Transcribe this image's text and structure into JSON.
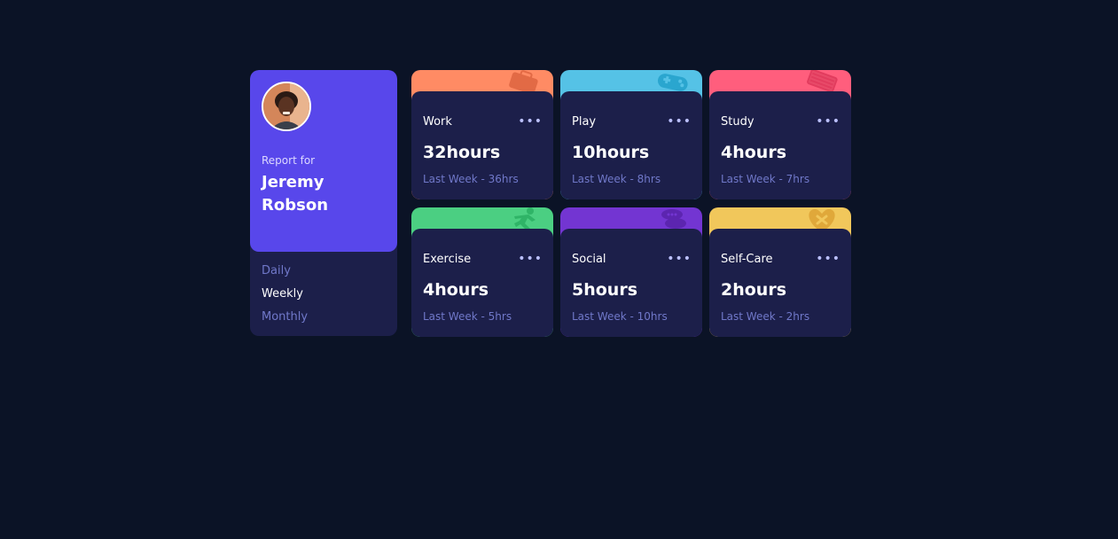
{
  "profile": {
    "report_label": "Report for",
    "name": "Jeremy Robson",
    "avatar": "user-avatar-photo"
  },
  "periods": [
    {
      "label": "Daily",
      "active": false
    },
    {
      "label": "Weekly",
      "active": true
    },
    {
      "label": "Monthly",
      "active": false
    }
  ],
  "menu_glyph": "•••",
  "cards": [
    {
      "title": "Work",
      "hours": "32hours",
      "last": "Last Week - 36hrs",
      "color": "#ff8b64",
      "icon": "briefcase-icon"
    },
    {
      "title": "Play",
      "hours": "10hours",
      "last": "Last Week - 8hrs",
      "color": "#55c2e6",
      "icon": "gamepad-icon"
    },
    {
      "title": "Study",
      "hours": "4hours",
      "last": "Last Week - 7hrs",
      "color": "#ff5e7d",
      "icon": "book-icon"
    },
    {
      "title": "Exercise",
      "hours": "4hours",
      "last": "Last Week - 5hrs",
      "color": "#4bcf82",
      "icon": "runner-icon"
    },
    {
      "title": "Social",
      "hours": "5hours",
      "last": "Last Week - 10hrs",
      "color": "#7335d2",
      "icon": "chat-bubbles-icon"
    },
    {
      "title": "Self-Care",
      "hours": "2hours",
      "last": "Last Week - 2hrs",
      "color": "#f1c75b",
      "icon": "heart-icon"
    }
  ]
}
